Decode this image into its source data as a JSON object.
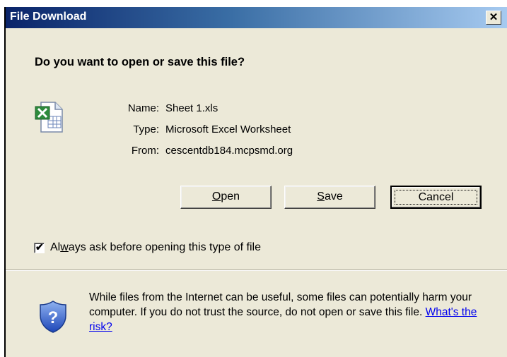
{
  "window": {
    "title": "File Download",
    "close_glyph": "✕"
  },
  "dialog": {
    "question": "Do you want to open or save this file?",
    "file_icon": "excel-file-icon",
    "info": [
      {
        "label": "Name:",
        "value": "Sheet 1.xls"
      },
      {
        "label": "Type:",
        "value": "Microsoft Excel Worksheet"
      },
      {
        "label": "From:",
        "value": "cescentdb184.mcpsmd.org"
      }
    ],
    "buttons": {
      "open": {
        "accel": "O",
        "rest": "pen"
      },
      "save": {
        "accel": "S",
        "rest": "ave"
      },
      "cancel": "Cancel"
    },
    "checkbox": {
      "checked": true,
      "label_pre": "Al",
      "label_accel": "w",
      "label_post": "ays ask before opening this type of file"
    },
    "warning": {
      "icon": "shield-question-icon",
      "text": "While files from the Internet can be useful, some files can potentially harm your computer. If you do not trust the source, do not open or save this file.",
      "link": "What's the risk?"
    }
  },
  "colors": {
    "titlebar": "#0a246a",
    "dialog_bg": "#ece9d8",
    "link": "#0000ee"
  }
}
